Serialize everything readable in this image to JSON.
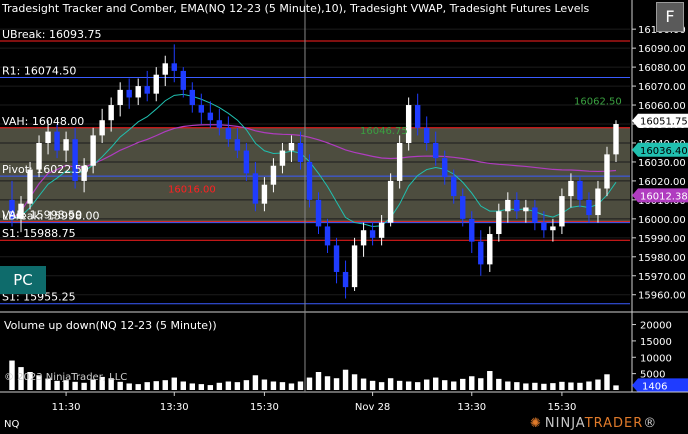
{
  "header": {
    "title": "Tradesight Tracker and Comber, EMA(NQ 12-23 (5 Minute),10), Tradesight VWAP, Tradesight Futures Levels",
    "side_button": "F"
  },
  "badge": {
    "label": "PC"
  },
  "volume_panel": {
    "title": "Volume up down(NQ 12-23 (5 Minute))"
  },
  "copyright": "© 2023 NinjaTrader, LLC",
  "symbol": "NQ",
  "logo": {
    "ninja": "NINJA",
    "trader": "TRADER",
    "mark": "®"
  },
  "colors": {
    "background": "#000000",
    "up_candle": "#ffffff",
    "down_candle": "#1f3cff",
    "ema": "#20c0b0",
    "vwap": "#b03cc0",
    "resistance": "#ff2020",
    "support": "#3a5cff",
    "value_area_fill": "#5a5a4a",
    "volume_bar": "#ffffff",
    "price_marker": "#ffffff",
    "ema_marker": "#20c0b0",
    "vwap_marker": "#b03cc0",
    "volume_marker": "#1f3cff"
  },
  "chart_data": [
    {
      "type": "candlestick",
      "instrument": "NQ 12-23 (5 Minute)",
      "ylim": [
        15953,
        16108
      ],
      "y_ticks": [
        16100,
        16090,
        16080,
        16070,
        16060,
        16050,
        16040,
        16030,
        16020,
        16010,
        16000,
        15990,
        15980,
        15970,
        15960
      ],
      "x_ticks": [
        "11:30",
        "13:30",
        "15:30",
        "Nov 28",
        "13:30",
        "15:30"
      ],
      "day_separator_after_tick": "15:30",
      "levels": [
        {
          "name": "UBreak",
          "value": 16093.75,
          "label": "UBreak: 16093.75",
          "kind": "resistance"
        },
        {
          "name": "R1",
          "value": 16074.5,
          "label": "R1: 16074.50",
          "kind": "support"
        },
        {
          "name": "VAH",
          "value": 16048.0,
          "label": "VAH: 16048.00",
          "kind": "resistance"
        },
        {
          "name": "Pivot",
          "value": 16022.5,
          "label": "Pivot: 16022.50",
          "kind": "support"
        },
        {
          "name": "VAL",
          "value": 15998.5,
          "label": "VAL: 15998.50",
          "kind": "resistance"
        },
        {
          "name": "LBreak",
          "value": 15998.0,
          "label": "LBreak: 15998.00",
          "kind": "support"
        },
        {
          "name": "S1",
          "value": 15988.75,
          "label": "S1: 15988.75",
          "kind": "resistance"
        },
        {
          "name": "S2",
          "value": 15955.25,
          "label": "S1: 15955.25",
          "kind": "support"
        }
      ],
      "inline_level_labels": [
        {
          "text": "16016.00",
          "value": 16016.0
        },
        {
          "text": "16062.50",
          "value": 16062.5
        },
        {
          "text": "16046.75",
          "value": 16046.75
        }
      ],
      "value_area": [
        15998.5,
        16048.0
      ],
      "last_price": {
        "value": 16051.75,
        "label": "16051.75"
      },
      "ema_last": {
        "value": 16036.4,
        "label": "16036.40"
      },
      "vwap_last": {
        "value": 16012.38,
        "label": "16012.38"
      },
      "candles": [
        [
          16010,
          16020,
          15996,
          16000
        ],
        [
          16000,
          16012,
          15993,
          16008
        ],
        [
          16008,
          16030,
          16005,
          16026
        ],
        [
          16026,
          16044,
          16022,
          16040
        ],
        [
          16040,
          16052,
          16034,
          16046
        ],
        [
          16046,
          16050,
          16032,
          16036
        ],
        [
          16036,
          16046,
          16030,
          16042
        ],
        [
          16042,
          16048,
          16016,
          16020
        ],
        [
          16020,
          16032,
          16014,
          16028
        ],
        [
          16028,
          16048,
          16024,
          16044
        ],
        [
          16044,
          16058,
          16040,
          16052
        ],
        [
          16052,
          16064,
          16046,
          16060
        ],
        [
          16060,
          16072,
          16054,
          16068
        ],
        [
          16068,
          16074,
          16058,
          16064
        ],
        [
          16064,
          16074,
          16060,
          16070
        ],
        [
          16070,
          16078,
          16062,
          16066
        ],
        [
          16066,
          16080,
          16062,
          16076
        ],
        [
          16076,
          16086,
          16070,
          16082
        ],
        [
          16082,
          16092,
          16072,
          16078
        ],
        [
          16078,
          16080,
          16064,
          16068
        ],
        [
          16068,
          16072,
          16056,
          16060
        ],
        [
          16060,
          16066,
          16050,
          16056
        ],
        [
          16056,
          16062,
          16048,
          16052
        ],
        [
          16052,
          16058,
          16044,
          16048
        ],
        [
          16048,
          16054,
          16038,
          16042
        ],
        [
          16042,
          16048,
          16032,
          16036
        ],
        [
          16036,
          16040,
          16020,
          16024
        ],
        [
          16024,
          16030,
          16004,
          16008
        ],
        [
          16008,
          16022,
          16004,
          16018
        ],
        [
          16018,
          16032,
          16014,
          16028
        ],
        [
          16028,
          16040,
          16024,
          16036
        ],
        [
          16036,
          16044,
          16030,
          16040
        ],
        [
          16040,
          16046,
          16026,
          16030
        ],
        [
          16030,
          16034,
          16006,
          16010
        ],
        [
          16010,
          16014,
          15992,
          15996
        ],
        [
          15996,
          16000,
          15982,
          15986
        ],
        [
          15986,
          15990,
          15966,
          15972
        ],
        [
          15972,
          15978,
          15958,
          15964
        ],
        [
          15964,
          15990,
          15962,
          15986
        ],
        [
          15986,
          15998,
          15980,
          15994
        ],
        [
          15994,
          15998,
          15986,
          15990
        ],
        [
          15990,
          16002,
          15986,
          15998
        ],
        [
          15998,
          16024,
          15996,
          16020
        ],
        [
          16020,
          16044,
          16016,
          16040
        ],
        [
          16040,
          16064,
          16036,
          16060
        ],
        [
          16060,
          16066,
          16044,
          16048
        ],
        [
          16048,
          16054,
          16036,
          16040
        ],
        [
          16040,
          16046,
          16028,
          16032
        ],
        [
          16032,
          16036,
          16018,
          16022
        ],
        [
          16022,
          16026,
          16008,
          16012
        ],
        [
          16012,
          16016,
          15996,
          16000
        ],
        [
          16000,
          16004,
          15982,
          15988
        ],
        [
          15988,
          15994,
          15970,
          15976
        ],
        [
          15976,
          15996,
          15972,
          15992
        ],
        [
          15992,
          16008,
          15988,
          16004
        ],
        [
          16004,
          16014,
          15998,
          16010
        ],
        [
          16010,
          16014,
          16000,
          16004
        ],
        [
          16004,
          16010,
          15998,
          16006
        ],
        [
          16006,
          16010,
          15994,
          15998
        ],
        [
          15998,
          16004,
          15990,
          15994
        ],
        [
          15994,
          16000,
          15988,
          15996
        ],
        [
          15996,
          16016,
          15992,
          16012
        ],
        [
          16012,
          16024,
          16006,
          16020
        ],
        [
          16020,
          16022,
          16006,
          16010
        ],
        [
          16010,
          16014,
          15998,
          16002
        ],
        [
          16002,
          16020,
          15998,
          16016
        ],
        [
          16016,
          16038,
          16012,
          16034
        ],
        [
          16034,
          16052,
          16030,
          16050
        ]
      ]
    },
    {
      "type": "bar",
      "title": "Volume up down(NQ 12-23 (5 Minute))",
      "ylim": [
        0,
        22000
      ],
      "y_ticks": [
        20000,
        15000,
        10000,
        5000
      ],
      "last_value": {
        "value": 1406,
        "label": "1406"
      },
      "values": [
        9000,
        7000,
        5500,
        4500,
        3500,
        2800,
        3000,
        2500,
        2200,
        3200,
        4000,
        3600,
        2500,
        2000,
        1800,
        2400,
        2700,
        3000,
        3800,
        2600,
        2000,
        1800,
        1500,
        2200,
        2600,
        2400,
        3000,
        4500,
        3200,
        2600,
        2400,
        2000,
        2600,
        3800,
        5500,
        4200,
        3600,
        6200,
        4800,
        3500,
        2800,
        2400,
        3600,
        2800,
        2600,
        2400,
        3200,
        3800,
        3000,
        2600,
        3400,
        4200,
        3600,
        5800,
        3400,
        2600,
        2400,
        2000,
        2200,
        1900,
        2100,
        2500,
        2300,
        2200,
        2600,
        3200,
        4800,
        1406
      ]
    }
  ]
}
